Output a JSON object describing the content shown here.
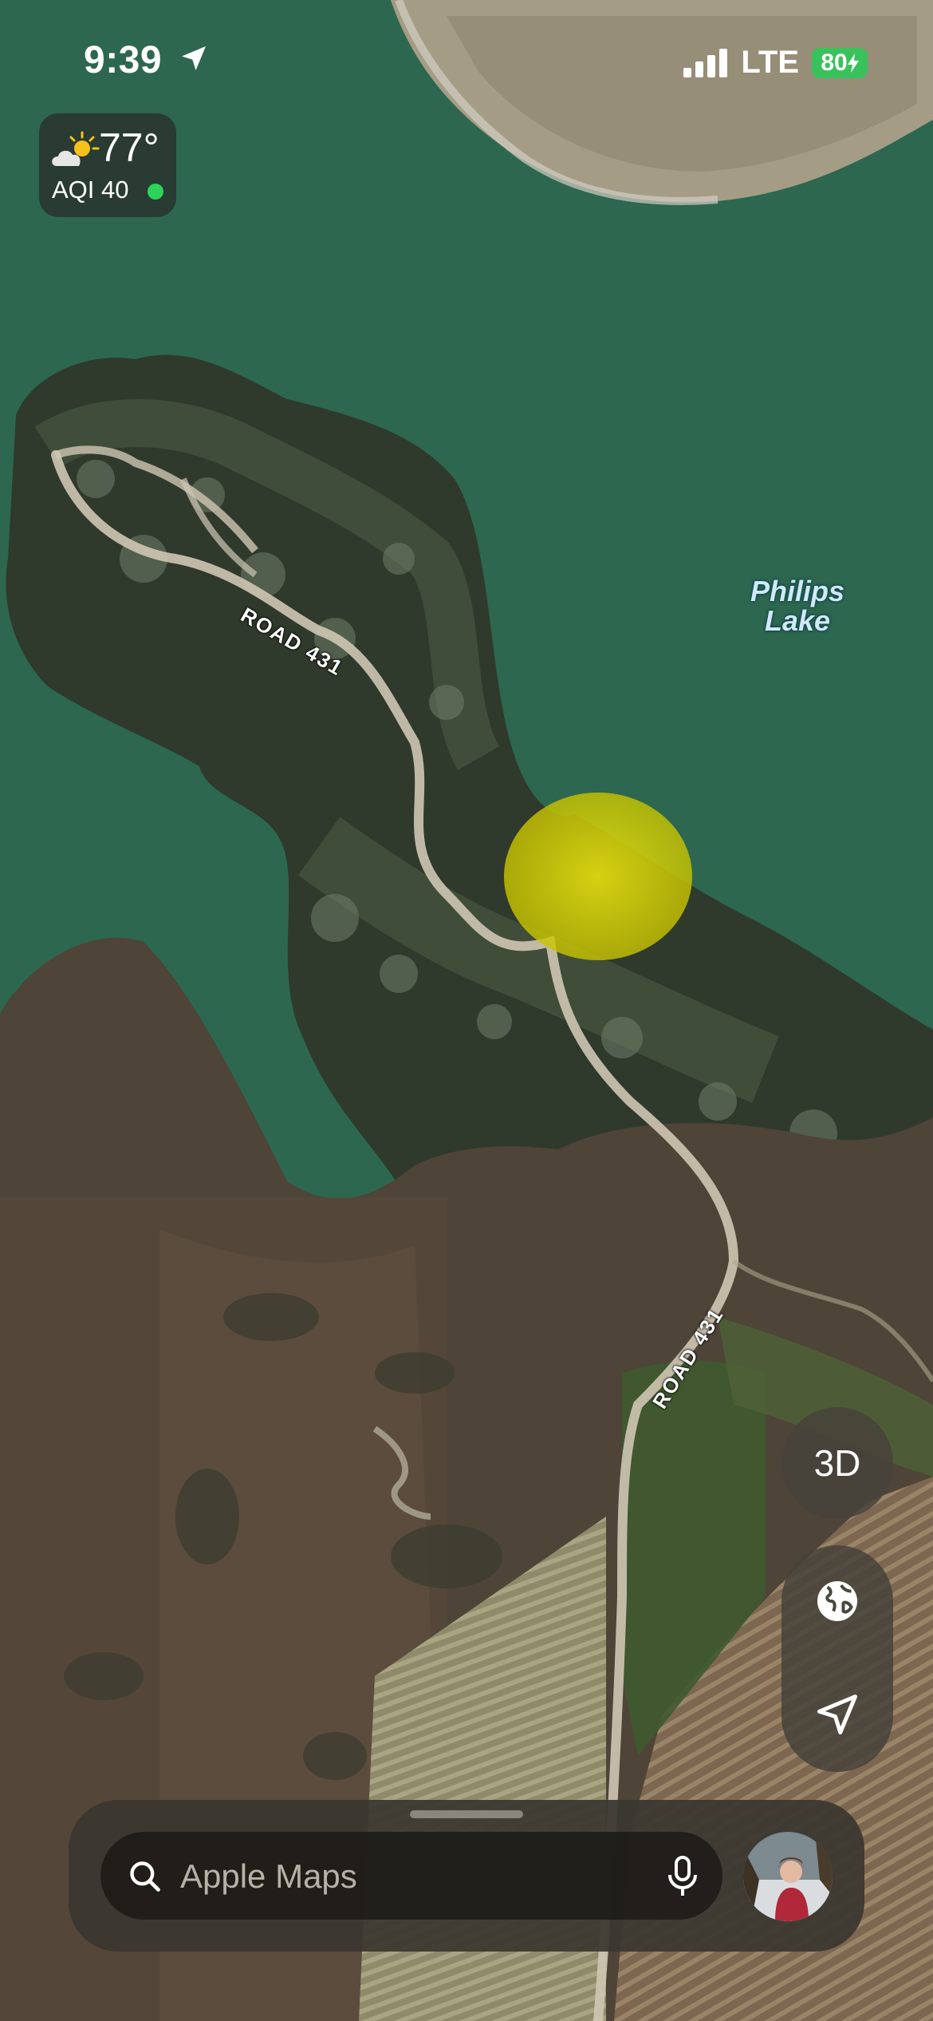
{
  "status_bar": {
    "time": "9:39",
    "network": "LTE",
    "battery_level": "80",
    "location_arrow_icon": "location-arrow-icon",
    "signal_icon": "cellular-signal-icon"
  },
  "weather": {
    "temperature": "77°",
    "aqi": "AQI 40",
    "condition_icon": "partly-sunny-icon",
    "aqi_status_color": "#2bd55a"
  },
  "map": {
    "type": "satellite",
    "lake_label": "Philips Lake",
    "road_label_top": "ROAD 431",
    "road_label_bottom": "ROAD 431",
    "highlight_color": "#d9d400",
    "water_color": "#2e6a4f"
  },
  "controls": {
    "view_3d_label": "3D",
    "globe_icon": "globe-icon",
    "locate_icon": "location-arrow-icon"
  },
  "search": {
    "placeholder": "Apple Maps",
    "search_icon": "search-icon",
    "mic_icon": "microphone-icon",
    "avatar": "profile-avatar"
  }
}
